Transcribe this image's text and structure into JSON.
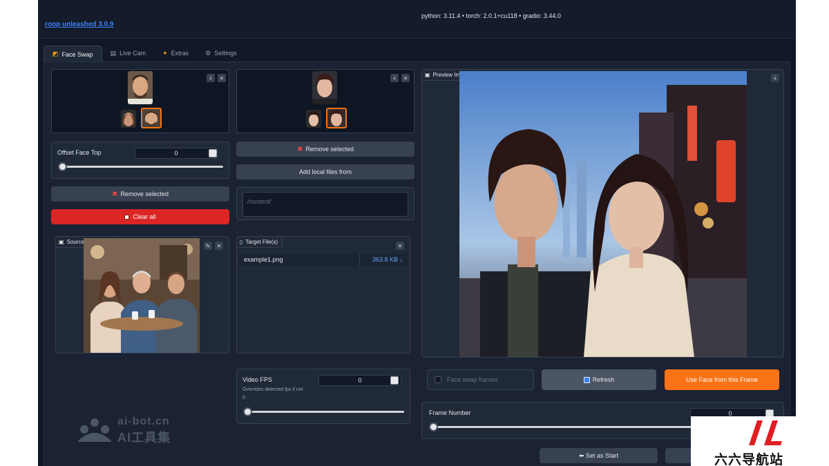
{
  "header": {
    "app_title": "roop unleashed 3.0.9",
    "versions": "python: 3.11.4  •  torch: 2.0.1+cu118  •  gradio: 3.44.0"
  },
  "tabs": [
    {
      "label": "Face Swap",
      "icon": "face-swap-icon",
      "active": true
    },
    {
      "label": "Live Cam",
      "icon": "camera-icon",
      "active": false
    },
    {
      "label": "Extras",
      "icon": "party-icon",
      "active": false
    },
    {
      "label": "Settings",
      "icon": "gear-icon",
      "active": false
    }
  ],
  "left": {
    "offset_label": "Offset Face Top",
    "offset_value": "0",
    "remove_selected": "Remove selected",
    "clear_all": "Clear all",
    "source_label": "Source Face Image"
  },
  "middle": {
    "remove_selected": "Remove selected",
    "add_local": "Add local files from",
    "path_placeholder": "/content/",
    "target_label": "Target File(s)",
    "file_name": "example1.png",
    "file_size": "363.8 KB ↓",
    "fps_label": "Video FPS",
    "fps_value": "0",
    "fps_note": "Overrides detected fps if not",
    "fps_note2": "0"
  },
  "right": {
    "preview_label": "Preview Image",
    "face_swap_frames": "Face swap frames",
    "refresh": "Refresh",
    "use_face": "Use Face from this Frame",
    "frame_number_label": "Frame Number",
    "frame_number_value": "0",
    "set_as_start": "⬅ Set as Start"
  },
  "watermarks": {
    "ai_bot_url": "ai-bot.cn",
    "ai_bot_name": "AI工具集",
    "site66": "六六导航站"
  },
  "colors": {
    "accent_orange": "#f97316",
    "danger_red": "#dc2626",
    "link_blue": "#3b82f6"
  }
}
